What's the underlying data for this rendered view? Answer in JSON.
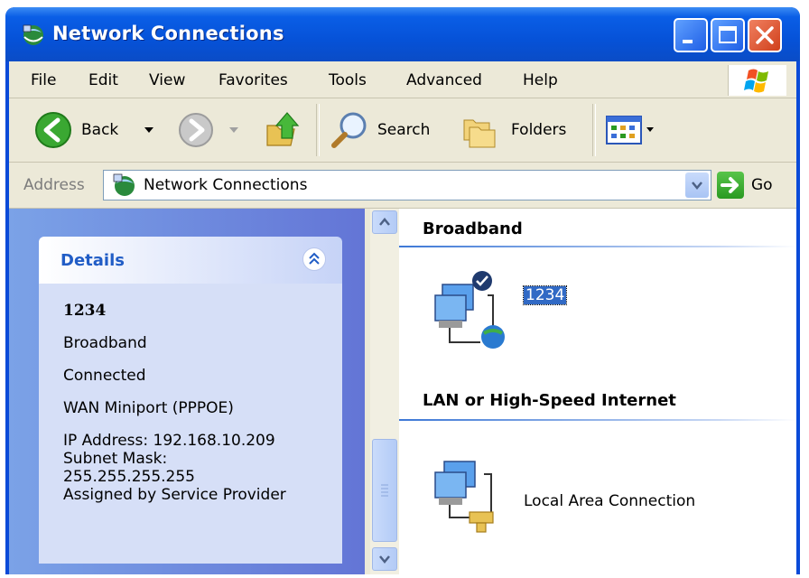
{
  "window": {
    "title": "Network Connections"
  },
  "menubar": {
    "items": [
      "File",
      "Edit",
      "View",
      "Favorites",
      "Tools",
      "Advanced",
      "Help"
    ]
  },
  "toolbar": {
    "back_label": "Back",
    "search_label": "Search",
    "folders_label": "Folders"
  },
  "address": {
    "label": "Address",
    "value": "Network Connections",
    "go_label": "Go"
  },
  "details": {
    "title": "Details",
    "name": "1234",
    "type": "Broadband",
    "status": "Connected",
    "device": "WAN Miniport (PPPOE)",
    "ip": "IP Address: 192.168.10.209",
    "subnet_label": "Subnet Mask:",
    "subnet_value": "255.255.255.255",
    "assigned": "Assigned by Service Provider"
  },
  "groups": [
    {
      "title": "Broadband",
      "items": [
        {
          "label": "1234",
          "selected": true
        }
      ]
    },
    {
      "title": "LAN or High-Speed Internet",
      "items": [
        {
          "label": "Local Area Connection",
          "selected": false
        }
      ]
    }
  ],
  "icons": {
    "title": "network-connections-icon",
    "back": "back-arrow-icon",
    "forward": "forward-arrow-icon",
    "up": "up-folder-icon",
    "search": "search-magnifier-icon",
    "folders": "folders-icon",
    "views": "views-icon"
  }
}
